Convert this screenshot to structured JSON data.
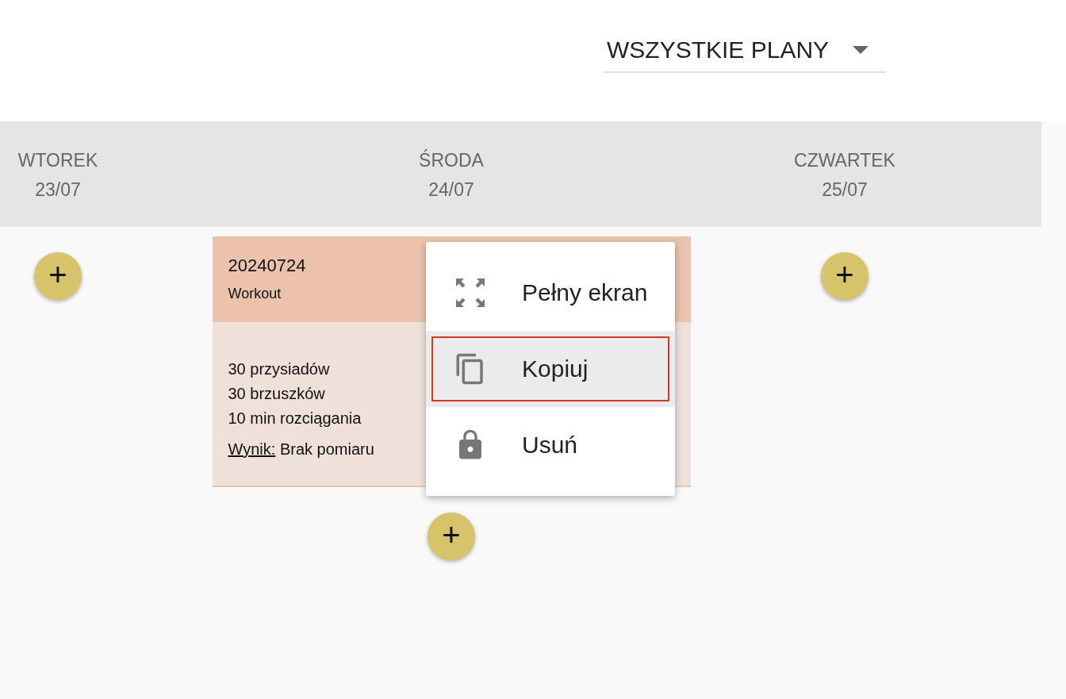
{
  "filter": {
    "value": "WSZYSTKIE PLANY"
  },
  "days": [
    {
      "name": "WTOREK",
      "date": "23/07",
      "add_label": "+"
    },
    {
      "name": "ŚRODA",
      "date": "24/07",
      "add_label": "+",
      "plan": {
        "title": "20240724",
        "type": "Workout",
        "lines": [
          "30 przysiadów",
          "30 brzuszków",
          "10 min rozciągania"
        ],
        "result_label": "Wynik:",
        "result": "Brak pomiaru"
      }
    },
    {
      "name": "CZWARTEK",
      "date": "25/07",
      "add_label": "+"
    }
  ],
  "menu": {
    "items": [
      {
        "label": "Pełny ekran",
        "selected": false
      },
      {
        "label": "Kopiuj",
        "selected": true
      },
      {
        "label": "Usuń",
        "selected": false
      }
    ]
  }
}
